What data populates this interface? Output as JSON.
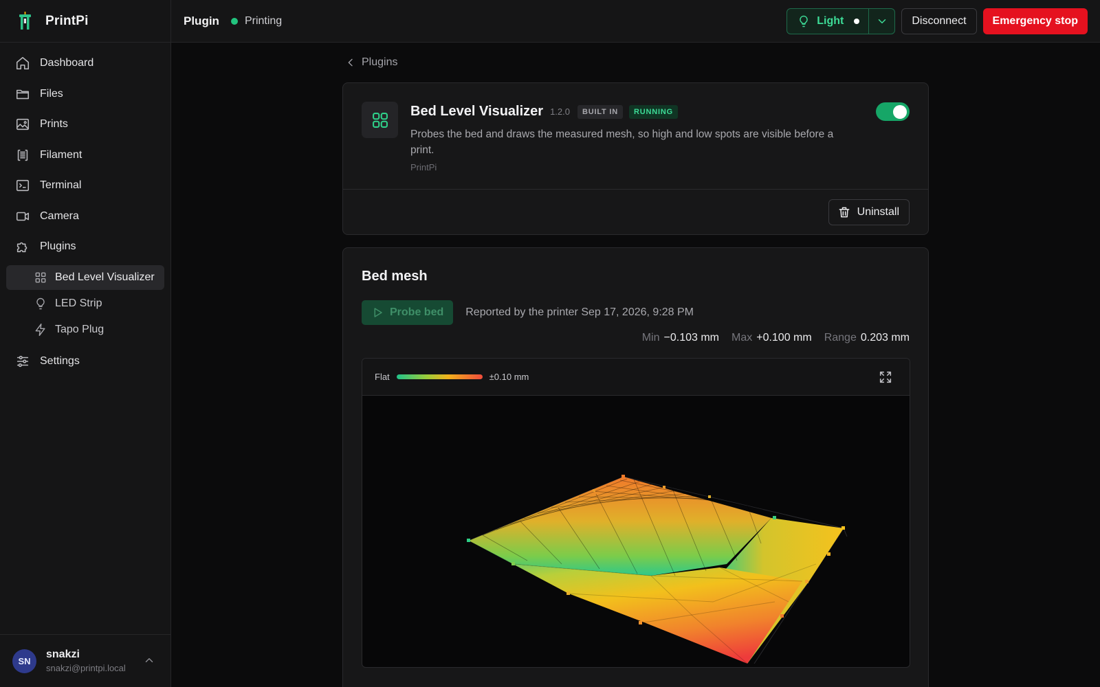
{
  "app": {
    "name": "PrintPi"
  },
  "sidebar": {
    "items": [
      {
        "label": "Dashboard",
        "icon": "home-icon"
      },
      {
        "label": "Files",
        "icon": "folder-icon"
      },
      {
        "label": "Prints",
        "icon": "image-icon"
      },
      {
        "label": "Filament",
        "icon": "filament-spool-icon"
      },
      {
        "label": "Terminal",
        "icon": "terminal-icon"
      },
      {
        "label": "Camera",
        "icon": "video-camera-icon"
      },
      {
        "label": "Plugins",
        "icon": "puzzle-icon"
      },
      {
        "label": "Settings",
        "icon": "sliders-icon"
      }
    ],
    "plugin_items": [
      {
        "label": "Bed Level Visualizer",
        "icon": "grid-icon",
        "active": true
      },
      {
        "label": "LED Strip",
        "icon": "lightbulb-icon"
      },
      {
        "label": "Tapo Plug",
        "icon": "lightning-icon"
      }
    ],
    "user": {
      "initials": "SN",
      "name": "snakzi",
      "email": "snakzi@printpi.local"
    }
  },
  "topbar": {
    "title": "Plugin",
    "status": "Printing",
    "light_label": "Light",
    "disconnect_label": "Disconnect",
    "emergency_label": "Emergency stop"
  },
  "breadcrumb": {
    "label": "Plugins"
  },
  "plugin": {
    "name": "Bed Level Visualizer",
    "version": "1.2.0",
    "badge_builtin": "BUILT IN",
    "badge_status": "RUNNING",
    "description": "Probes the bed and draws the measured mesh, so high and low spots are visible before a print.",
    "author": "PrintPi",
    "enabled": true,
    "uninstall_label": "Uninstall"
  },
  "mesh": {
    "title": "Bed mesh",
    "probe_label": "Probe bed",
    "reported": "Reported by the printer Sep 17, 2026, 9:28 PM",
    "stats": {
      "min_label": "Min",
      "min_value": "−0.103 mm",
      "max_label": "Max",
      "max_value": "+0.100 mm",
      "range_label": "Range",
      "range_value": "0.203 mm"
    },
    "legend": {
      "flat_label": "Flat",
      "scale_label": "±0.10 mm"
    }
  },
  "colors": {
    "accent": "#22c37e",
    "danger": "#e5111f",
    "mesh_low": "#22c38a",
    "mesh_mid": "#f2b21c",
    "mesh_high": "#f04c3c"
  }
}
